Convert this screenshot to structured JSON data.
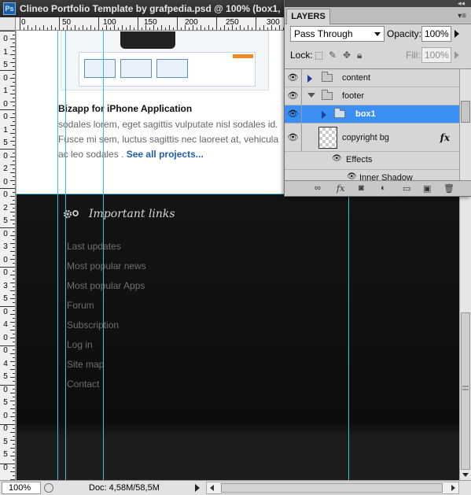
{
  "window": {
    "title": "Clineo Portfolio Template by grafpedia.psd @ 100% (box1,",
    "app_icon": "Ps"
  },
  "ruler": {
    "h_labels": [
      "0",
      "50",
      "100",
      "150",
      "200",
      "250",
      "300"
    ]
  },
  "canvas": {
    "project_title": "Bizapp for iPhone Application",
    "project_desc": "sodales lorem, eget sagittis vulputate nisl sodales id. Fusce mi sem, luctus sagittis  nec laoreet at, vehicula ac leo sodales .",
    "see_all": "See all projects...",
    "footer_heading": "Important links",
    "links": [
      "Last updates",
      "Most popular news",
      "Most popular Apps",
      "Forum",
      "Subscription",
      "Log in",
      "Site map",
      "Contact"
    ],
    "colors": {
      "guide": "#35c4d6",
      "link": "#6f6f6f",
      "accent_link": "#1f5fb0"
    }
  },
  "status": {
    "zoom": "100%",
    "doc_size": "Doc: 4,58M/58,5M"
  },
  "layers_panel": {
    "tab_label": "LAYERS",
    "blend_mode": "Pass Through",
    "opacity_label": "Opacity:",
    "opacity_value": "100%",
    "lock_label": "Lock:",
    "fill_label": "Fill:",
    "fill_value": "100%",
    "layers": [
      {
        "name": "content"
      },
      {
        "name": "footer"
      },
      {
        "name": "box1"
      },
      {
        "name": "copyright bg"
      },
      {
        "name": "Effects"
      },
      {
        "name": "Inner Shadow"
      }
    ],
    "selection_color": "#3b8ff2"
  }
}
